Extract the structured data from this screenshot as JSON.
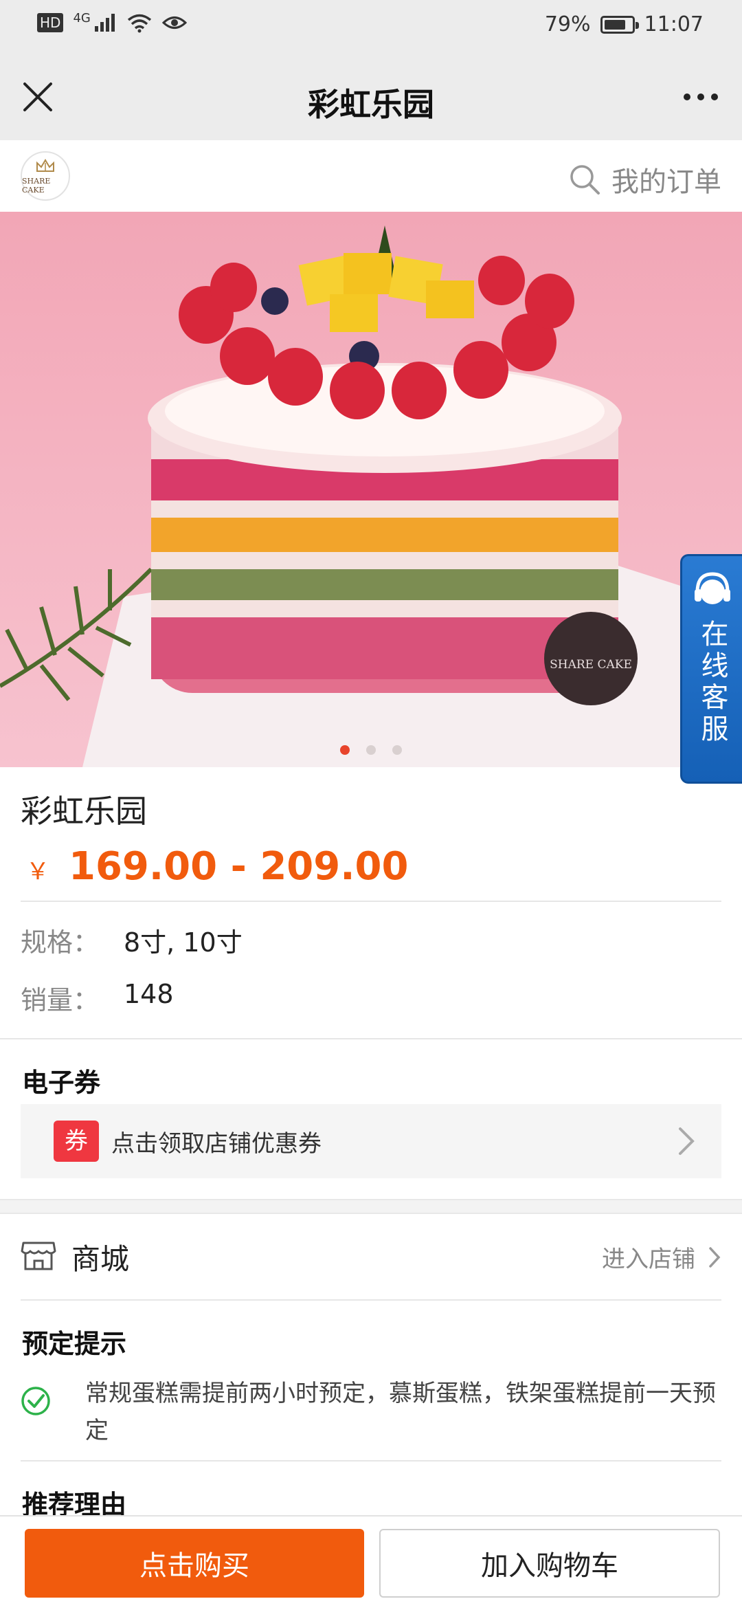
{
  "status_bar": {
    "network_hd": "HD",
    "network_gen": "4G",
    "battery_percent": "79%",
    "battery_level": 0.79,
    "time": "11:07"
  },
  "nav": {
    "title": "彩虹乐园",
    "close_icon": "close-icon",
    "more_icon": "more-icon"
  },
  "store": {
    "logo_text": "SHARE CAKE",
    "orders_label": "我的订单"
  },
  "hero": {
    "badge_text": "SHARE CAKE",
    "carousel_count": 3,
    "carousel_active": 1
  },
  "customer_service": {
    "label": "在线客服"
  },
  "product": {
    "name": "彩虹乐园",
    "currency": "￥",
    "price_range": "169.00 - 209.00",
    "spec_label": "规格：",
    "spec_value": "8寸, 10寸",
    "sales_label": "销量：",
    "sales_value": "148"
  },
  "coupon": {
    "section_title": "电子券",
    "tag": "券",
    "text": "点击领取店铺优惠券"
  },
  "mall": {
    "label": "商城",
    "enter_label": "进入店铺"
  },
  "booking_tip": {
    "title": "预定提示",
    "text": "常规蛋糕需提前两小时预定，慕斯蛋糕，铁架蛋糕提前一天预定"
  },
  "recommend": {
    "title": "推荐理由"
  },
  "actions": {
    "buy_label": "点击购买",
    "cart_label": "加入购物车"
  },
  "colors": {
    "accent": "#f15b0d",
    "coupon_tag": "#ef3740",
    "cs_blue": "#1f6fc6",
    "check_green": "#2db24a"
  }
}
